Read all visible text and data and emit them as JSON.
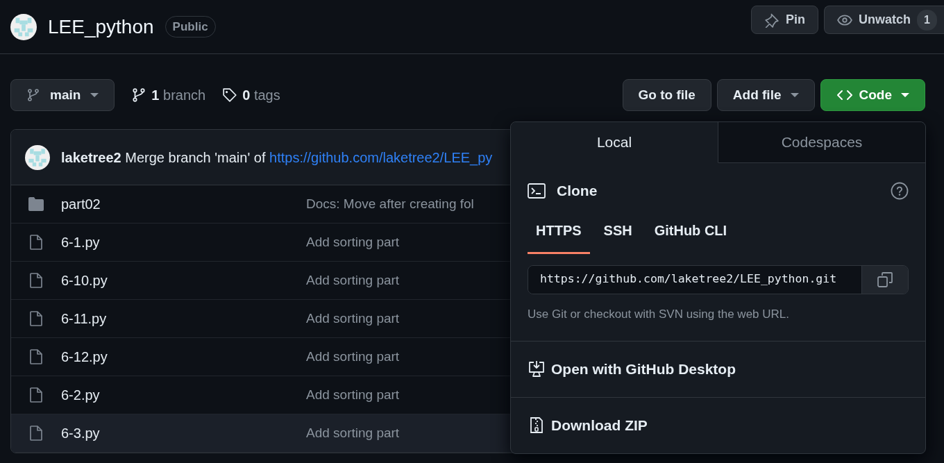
{
  "repo": {
    "name": "LEE_python",
    "visibility": "Public"
  },
  "header_buttons": [
    {
      "kind": "pin",
      "label": "Pin"
    },
    {
      "kind": "watch",
      "label": "Unwatch",
      "count": "1"
    }
  ],
  "branch_select": {
    "label": "main"
  },
  "stats": [
    {
      "kind": "branch",
      "count": "1",
      "label": "branch"
    },
    {
      "kind": "tag",
      "count": "0",
      "label": "tags"
    }
  ],
  "actions": [
    {
      "kind": "plain",
      "label": "Go to file",
      "dropdown": false
    },
    {
      "kind": "plain",
      "label": "Add file",
      "dropdown": true
    },
    {
      "kind": "primary",
      "label": "Code",
      "dropdown": true
    }
  ],
  "commit": {
    "author": "laketree2",
    "message": "Merge branch 'main' of",
    "link": "https://github.com/laketree2/LEE_py"
  },
  "files": [
    {
      "kind": "folder",
      "name": "part02",
      "message": "Docs: Move after creating fol",
      "hovered": false
    },
    {
      "kind": "file",
      "name": "6-1.py",
      "message": "Add sorting part",
      "hovered": false
    },
    {
      "kind": "file",
      "name": "6-10.py",
      "message": "Add sorting part",
      "hovered": false
    },
    {
      "kind": "file",
      "name": "6-11.py",
      "message": "Add sorting part",
      "hovered": false
    },
    {
      "kind": "file",
      "name": "6-12.py",
      "message": "Add sorting part",
      "hovered": false
    },
    {
      "kind": "file",
      "name": "6-2.py",
      "message": "Add sorting part",
      "hovered": false
    },
    {
      "kind": "file",
      "name": "6-3.py",
      "message": "Add sorting part",
      "hovered": true
    }
  ],
  "clone_menu": {
    "tabs": [
      {
        "label": "Local",
        "selected": true
      },
      {
        "label": "Codespaces",
        "selected": false
      }
    ],
    "title": "Clone",
    "protocols": [
      {
        "label": "HTTPS",
        "selected": true
      },
      {
        "label": "SSH",
        "selected": false
      },
      {
        "label": "GitHub CLI",
        "selected": false
      }
    ],
    "url": "https://github.com/laketree2/LEE_python.git",
    "hint": "Use Git or checkout with SVN using the web URL.",
    "options": [
      {
        "kind": "desktop",
        "label": "Open with GitHub Desktop"
      },
      {
        "kind": "zip",
        "label": "Download ZIP"
      }
    ]
  }
}
